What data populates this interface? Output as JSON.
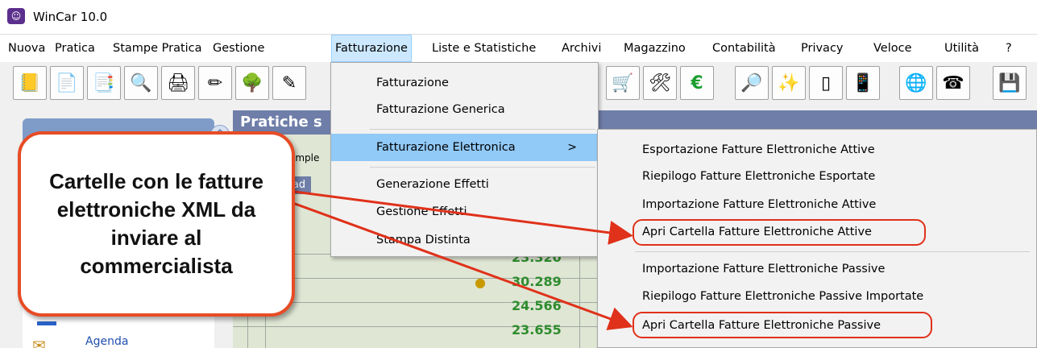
{
  "window": {
    "title": "WinCar 10.0",
    "app_icon": "wincar-app-icon"
  },
  "menubar": {
    "items": [
      "Nuova",
      "Pratica",
      "Stampe Pratica",
      "Gestione",
      "Fatturazione",
      "Liste e Statistiche",
      "Archivi",
      "Magazzino",
      "Contabilità",
      "Privacy",
      "Veloce",
      "Utilità",
      "?"
    ],
    "active": "Fatturazione"
  },
  "toolbar": {
    "icons": [
      "book-icon",
      "new-document-icon",
      "copy-document-icon",
      "print-preview-icon",
      "printer-icon",
      "pencil-icon",
      "tree-icon",
      "edit-icon",
      "cart-icon",
      "tools-icon",
      "euro-icon",
      "search-folder-icon",
      "magic-wand-icon",
      "tablet-icon",
      "phone-card-icon",
      "globe-icon",
      "telephone-icon",
      "save-icon"
    ]
  },
  "left_panel": {
    "agenda_label": "Agenda"
  },
  "main": {
    "title": "Pratiche s",
    "column_header": "omple",
    "ipad_cell": "iPad",
    "values": [
      "23.320",
      "30.289",
      "24.566",
      "23.655"
    ]
  },
  "dropdown": {
    "items": [
      {
        "label": "Fatturazione"
      },
      {
        "label": "Fatturazione Generica"
      },
      {
        "label": "Fatturazione Elettronica",
        "submenu": true
      },
      {
        "label": "Generazione Effetti"
      },
      {
        "label": "Gestione Effetti"
      },
      {
        "label": "Stampa Distinta"
      }
    ],
    "submenu_arrow": ">"
  },
  "submenu": {
    "items": [
      "Esportazione Fatture Elettroniche Attive",
      "Riepilogo Fatture Elettroniche Esportate",
      "Importazione Fatture Elettroniche Attive",
      "Apri Cartella Fatture Elettroniche Attive",
      "Importazione Fatture Elettroniche Passive",
      "Riepilogo Fatture Elettroniche Passive Importate",
      "Apri Cartella Fatture Elettroniche Passive"
    ]
  },
  "callout": {
    "text": "Cartelle con le fatture elettroniche XML da inviare al commercialista"
  },
  "colors": {
    "highlight": "#91c9f7",
    "annotation_red": "#e0311a",
    "values_green": "#2f8c2f",
    "header_blue": "#6f7ea8"
  }
}
